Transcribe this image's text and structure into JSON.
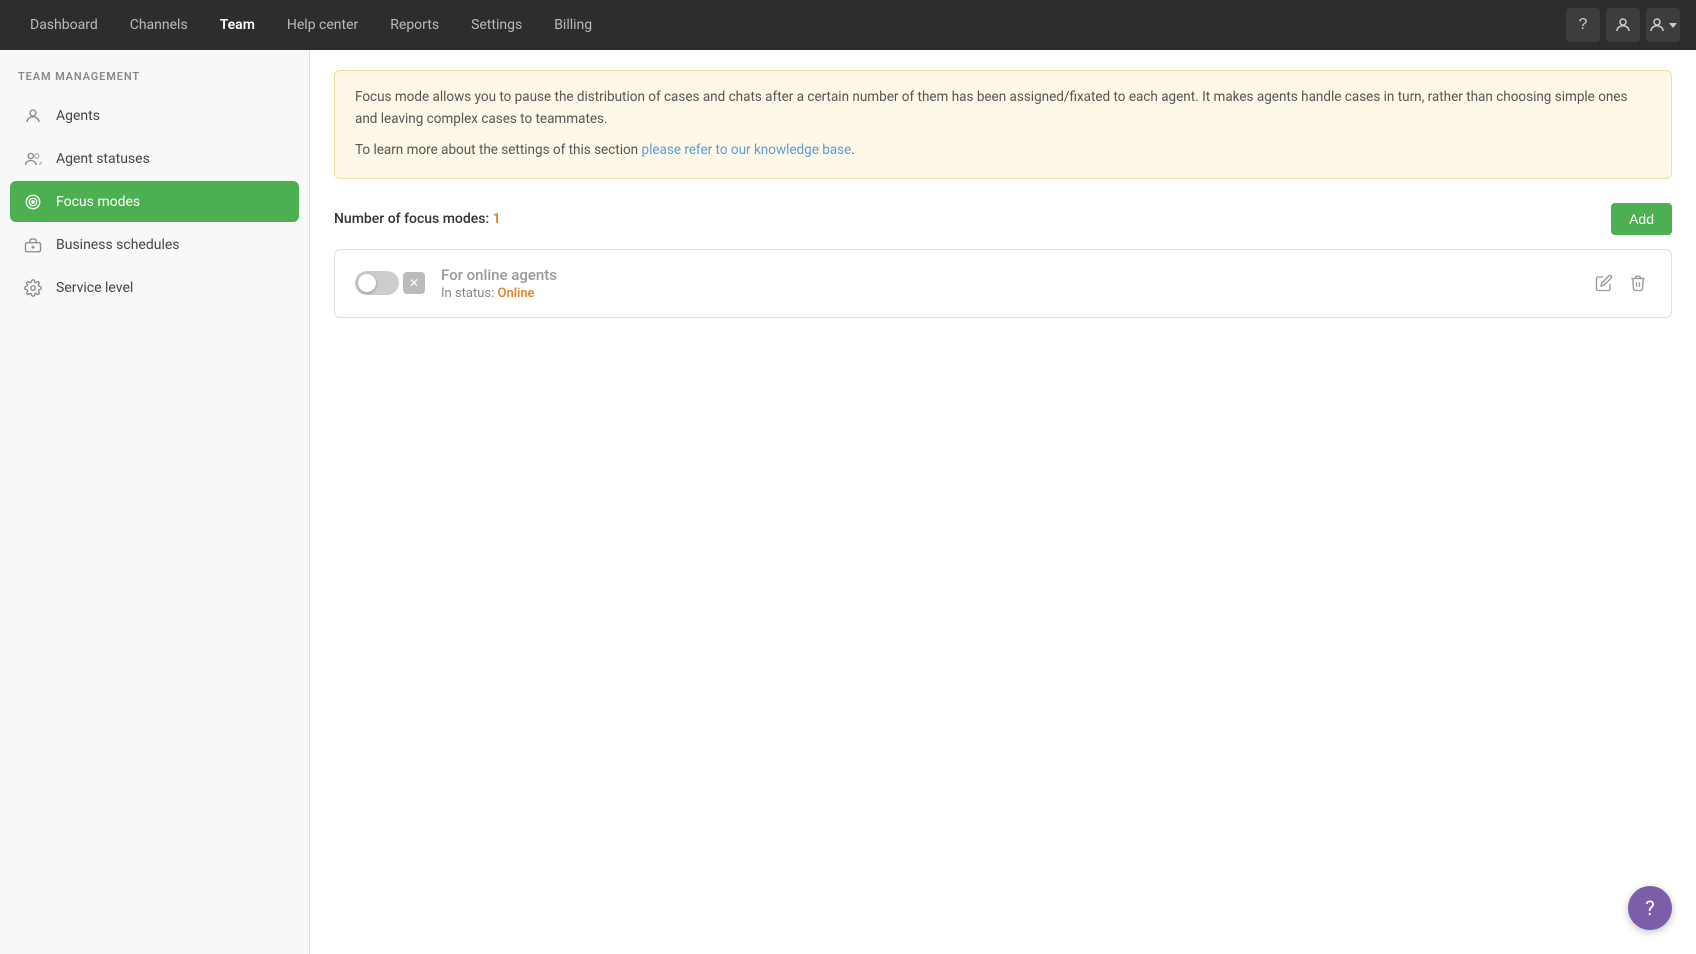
{
  "nav": {
    "items": [
      {
        "id": "dashboard",
        "label": "Dashboard",
        "active": false
      },
      {
        "id": "channels",
        "label": "Channels",
        "active": false
      },
      {
        "id": "team",
        "label": "Team",
        "active": true
      },
      {
        "id": "help-center",
        "label": "Help center",
        "active": false
      },
      {
        "id": "reports",
        "label": "Reports",
        "active": false
      },
      {
        "id": "settings",
        "label": "Settings",
        "active": false
      },
      {
        "id": "billing",
        "label": "Billing",
        "active": false
      }
    ]
  },
  "sidebar": {
    "title": "TEAM MANAGEMENT",
    "items": [
      {
        "id": "agents",
        "label": "Agents",
        "icon": "person"
      },
      {
        "id": "agent-statuses",
        "label": "Agent statuses",
        "icon": "people"
      },
      {
        "id": "focus-modes",
        "label": "Focus modes",
        "icon": "target",
        "active": true
      },
      {
        "id": "business-schedules",
        "label": "Business schedules",
        "icon": "briefcase"
      },
      {
        "id": "service-level",
        "label": "Service level",
        "icon": "gear"
      }
    ]
  },
  "main": {
    "info_text_1": "Focus mode allows you to pause the distribution of cases and chats after a certain number of them has been assigned/fixated to each agent. It makes agents handle cases in turn, rather than choosing simple ones and leaving complex cases to teammates.",
    "info_text_2": "To learn more about the settings of this section ",
    "info_link": "please refer to our knowledge base",
    "info_link_suffix": ".",
    "focus_count_label": "Number of focus modes:",
    "focus_count": "1",
    "add_button": "Add",
    "card": {
      "name": "For online agents",
      "status_prefix": "In status:",
      "status_value": "Online"
    }
  }
}
